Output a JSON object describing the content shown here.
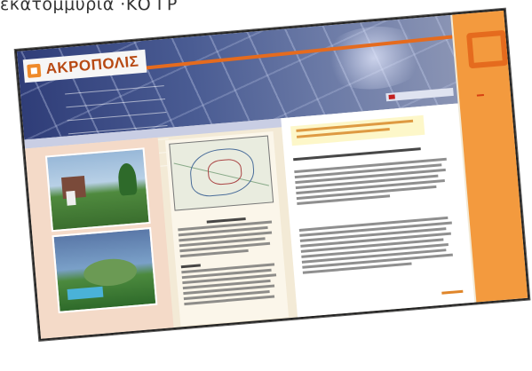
{
  "caption": "εκατομμύρια ·ΚΟ ΓΡ",
  "logo": {
    "text": "ΑΚΡΟΠΟΛΙΣ",
    "accent_color": "#ef8a2a"
  },
  "nav": {
    "items": [
      "",
      "",
      "",
      "",
      "",
      "",
      ""
    ]
  },
  "breadcrumb": "",
  "colors": {
    "orange": "#f39a3e",
    "header": "#3f4f86",
    "left_panel": "#f4dac8"
  }
}
